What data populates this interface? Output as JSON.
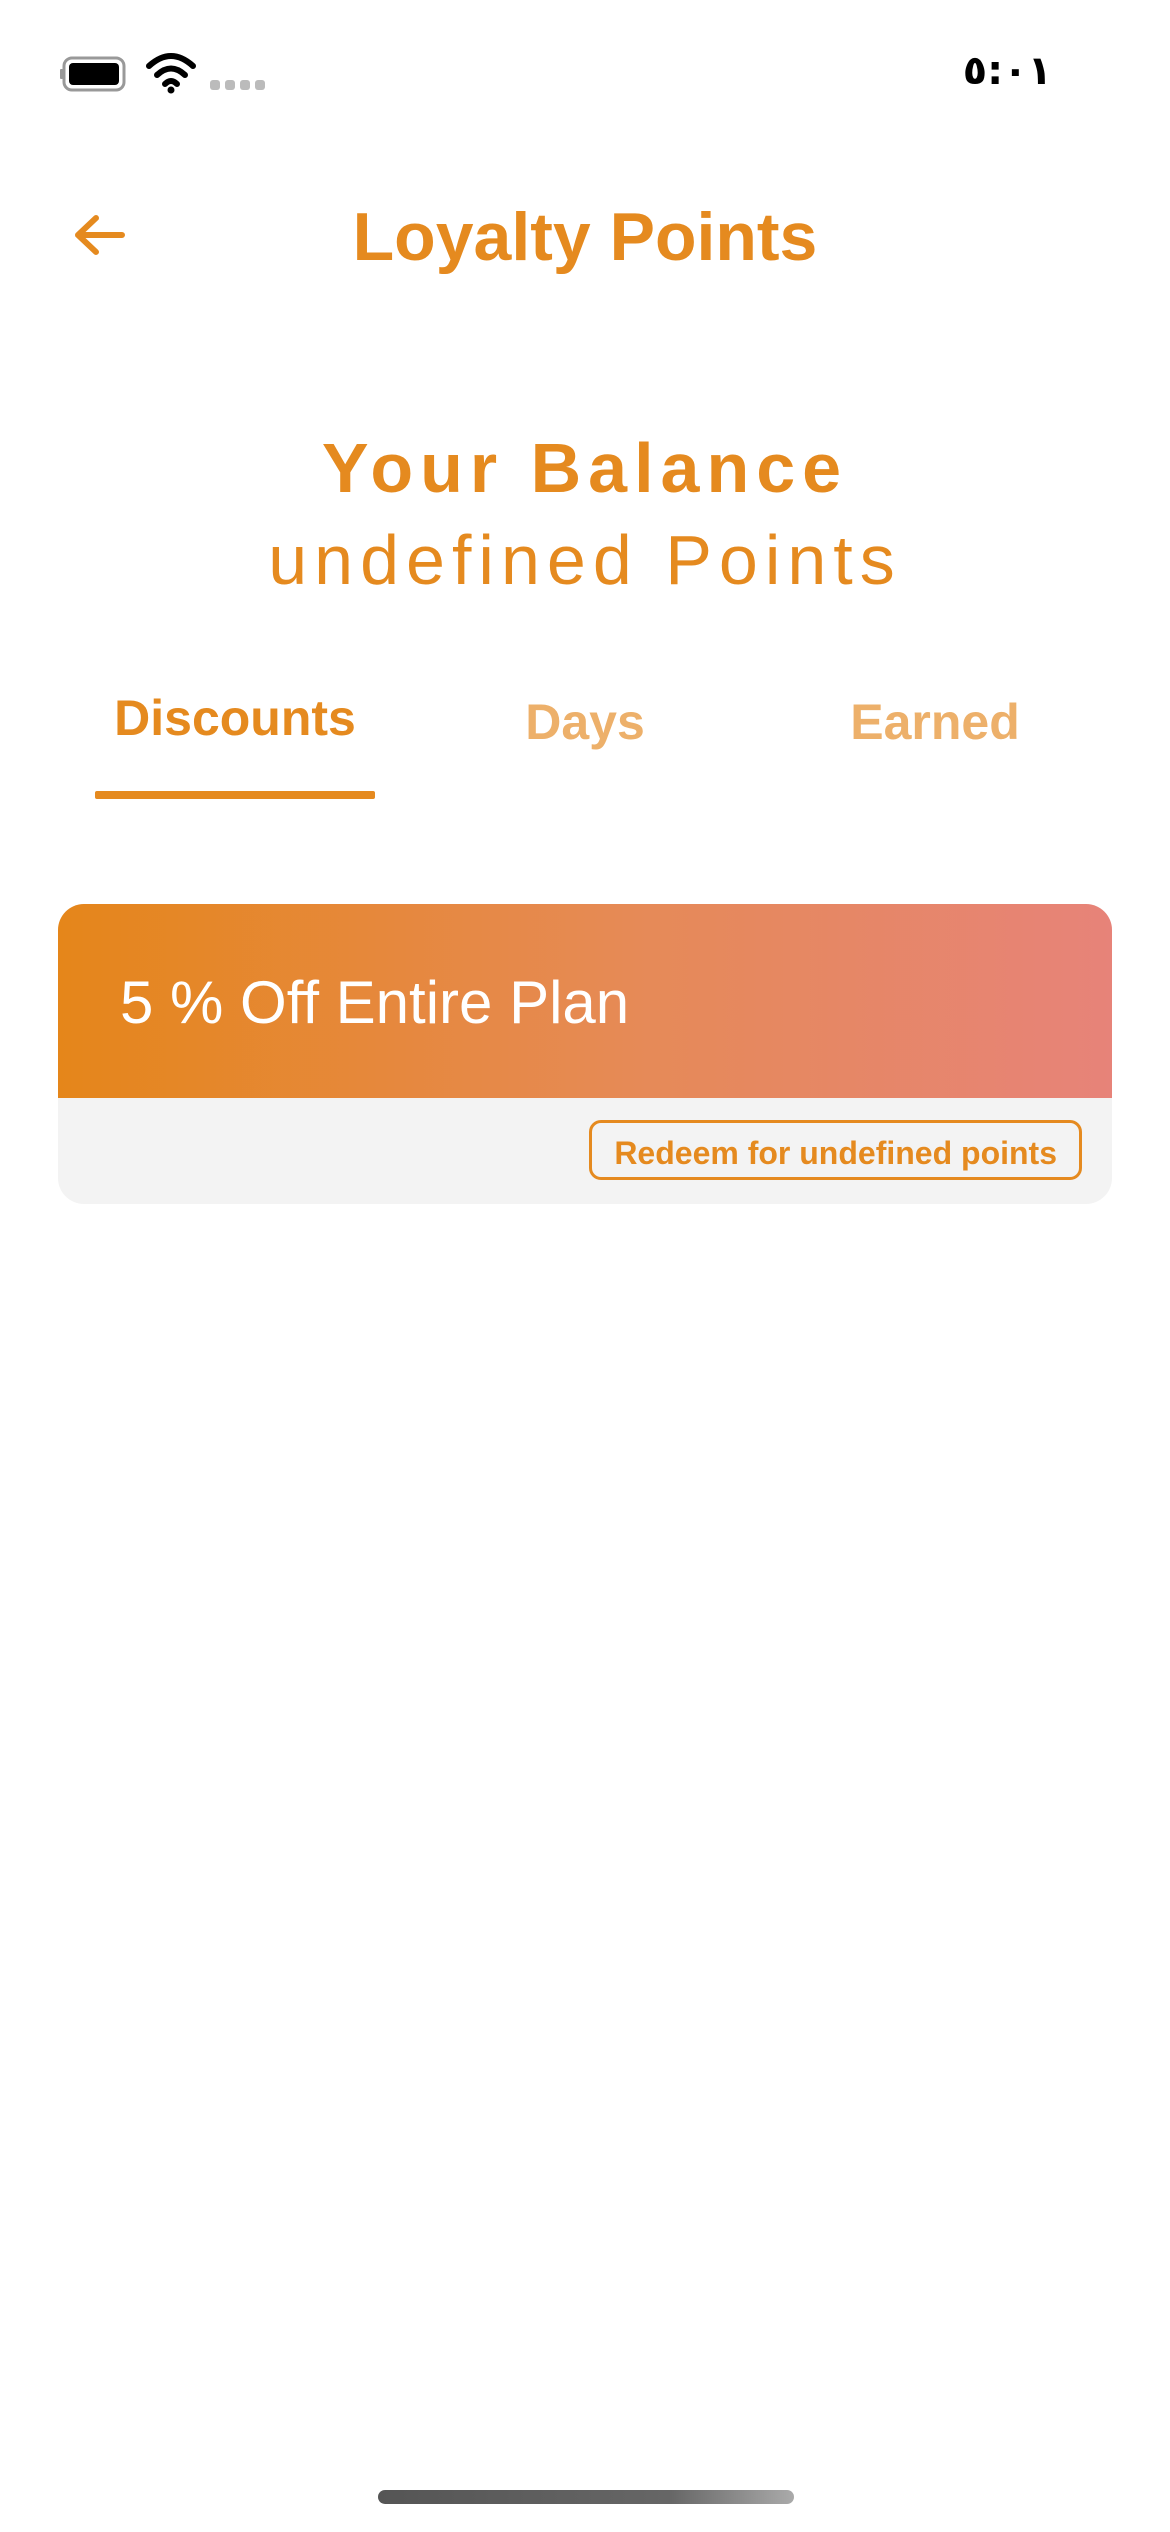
{
  "status_bar": {
    "time": "٥:٠١",
    "icons": [
      "battery-icon",
      "wifi-icon",
      "cellular-signal-icon"
    ]
  },
  "header": {
    "back_icon": "arrow-left-icon",
    "title": "Loyalty Points"
  },
  "balance": {
    "heading": "Your Balance",
    "value": "undefined Points"
  },
  "tabs": [
    {
      "label": "Discounts",
      "active": true
    },
    {
      "label": "Days",
      "active": false
    },
    {
      "label": "Earned",
      "active": false
    }
  ],
  "offers": [
    {
      "title": "5 % Off Entire Plan",
      "button_label": "Redeem for undefined points"
    }
  ],
  "colors": {
    "accent": "#E58A1F",
    "accent_light": "#EDB06A",
    "gradient_start": "#E5861A",
    "gradient_end": "#E78379",
    "card_bg": "#F3F3F3"
  }
}
